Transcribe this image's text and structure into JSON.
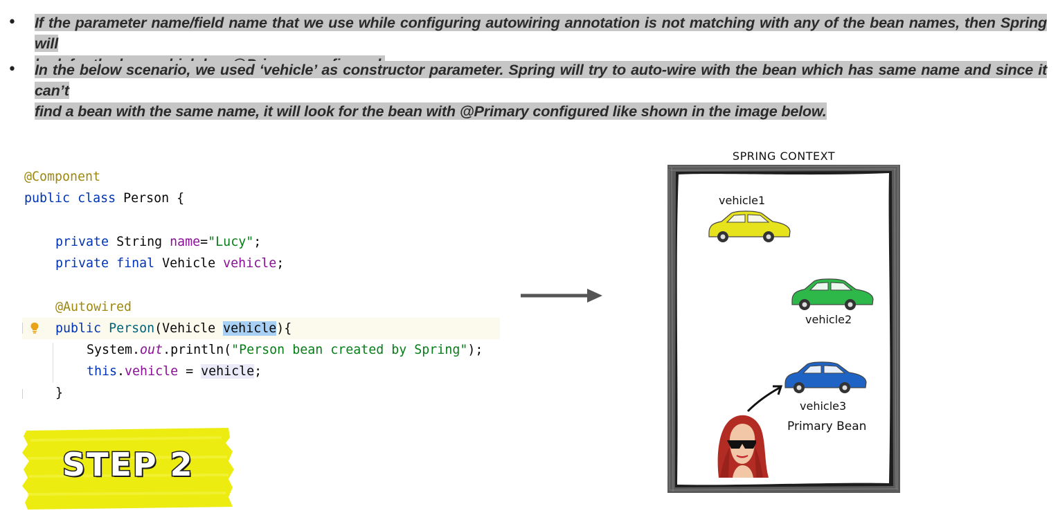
{
  "bullets": [
    {
      "marker": "•",
      "line1": "If the parameter name/field name that we use while configuring autowiring annotation is not matching with any of the bean names, then Spring will",
      "line2": "look for the bean which has @Primary configured."
    },
    {
      "marker": "•",
      "line1": "In the below scenario, we used ‘vehicle’ as constructor parameter. Spring will try to auto-wire with the bean which has same name and since it can’t",
      "line2": "find a bean with the same name, it will look for the bean with @Primary configured like shown in the image below."
    }
  ],
  "code": {
    "l1_annotation": "@Component",
    "l2_public": "public",
    "l2_class": "class",
    "l2_name": "Person {",
    "l3_private": "private",
    "l3_type": "String",
    "l3_field": "name",
    "l3_eq": "=",
    "l3_value": "\"Lucy\"",
    "l3_end": ";",
    "l4_private": "private",
    "l4_final": "final",
    "l4_type": "Vehicle",
    "l4_field": "vehicle",
    "l4_end": ";",
    "l5_annotation": "@Autowired",
    "l6_public": "public",
    "l6_ctor": "Person",
    "l6_open": "(Vehicle ",
    "l6_param": "vehicle",
    "l6_close": "){",
    "l7_system": "System.",
    "l7_out": "out",
    "l7_println": ".println(",
    "l7_str": "\"Person bean created by Spring\"",
    "l7_end": ");",
    "l8_this": "this",
    "l8_dot": ".",
    "l8_field": "vehicle",
    "l8_eq": " = ",
    "l8_param": "vehicle",
    "l8_end": ";",
    "l9_brace": "}"
  },
  "step_label": "STEP 2",
  "context": {
    "title": "SPRING CONTEXT",
    "beans": [
      {
        "label": "vehicle1",
        "color": "#e6e21c"
      },
      {
        "label": "vehicle2",
        "color": "#2fb84a"
      },
      {
        "label": "vehicle3",
        "color": "#1f63c4"
      }
    ],
    "primary_label": "Primary Bean"
  },
  "colors": {
    "highlight": "#c6c6c6",
    "step_banner": "#ecec10",
    "arrow": "#555555",
    "frame": "#444444"
  }
}
